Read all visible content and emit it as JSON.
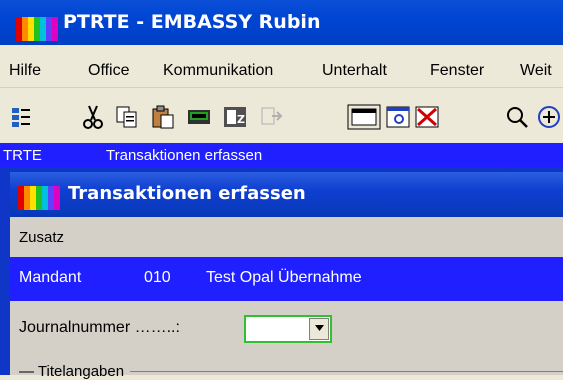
{
  "window": {
    "title": "PTRTE - EMBASSY Rubin"
  },
  "menubar": {
    "items": [
      {
        "label": "Hilfe"
      },
      {
        "label": "Office"
      },
      {
        "label": "Kommunikation"
      },
      {
        "label": "Unterhalt"
      },
      {
        "label": "Fenster"
      },
      {
        "label": "Weit"
      }
    ]
  },
  "toolbar": {
    "icons": [
      "tree-view-icon",
      "cut-icon",
      "copy-icon",
      "paste-icon",
      "keyboard-icon",
      "zoom-field-icon",
      "disabled-export-icon",
      "window-icon",
      "preview-icon",
      "close-x-icon",
      "search-icon",
      "add-icon"
    ]
  },
  "status": {
    "code": "TRTE",
    "text": "Transaktionen erfassen"
  },
  "child_window": {
    "title": "Transaktionen erfassen",
    "menu": {
      "zusatz": "Zusatz"
    },
    "mandant": {
      "label": "Mandant",
      "number": "010",
      "name": "Test Opal Übernahme"
    },
    "form": {
      "journal_label": "Journalnummer ……..:",
      "journal_value": "",
      "section_label": "Titelangaben"
    }
  },
  "colors": {
    "titlebar": "#0045d3",
    "status_strip": "#1f1fff",
    "form_bg": "#d4d0c8"
  }
}
